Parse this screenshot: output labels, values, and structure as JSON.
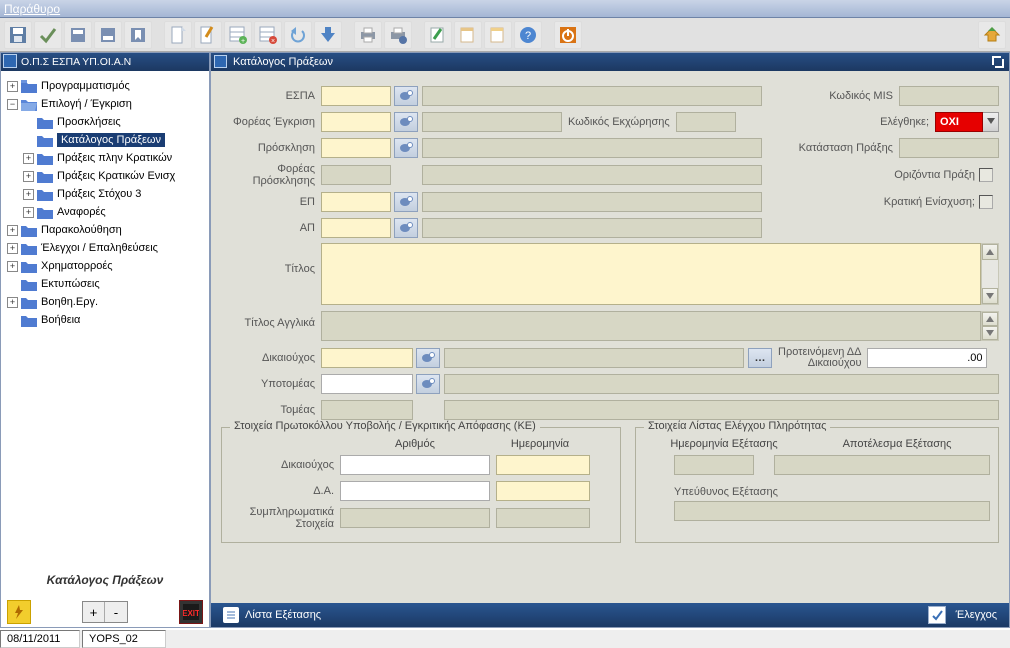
{
  "menu": {
    "window": "Παράθυρο"
  },
  "tree_panel_title": "Ο.Π.Σ ΕΣΠΑ ΥΠ.ΟΙ.Α.Ν",
  "tree": {
    "n1": "Προγραμματισμός",
    "n2": "Επιλογή / Έγκριση",
    "n2_1": "Προσκλήσεις",
    "n2_2": "Κατάλογος Πράξεων",
    "n2_3": "Πράξεις πλην Κρατικών",
    "n2_4": "Πράξεις Κρατικών Ενισχ",
    "n2_5": "Πράξεις Στόχου 3",
    "n2_6": "Αναφορές",
    "n3": "Παρακολούθηση",
    "n4": "Έλεγχοι / Επαληθεύσεις",
    "n5": "Χρηματορροές",
    "n6": "Εκτυπώσεις",
    "n7": "Βοηθη.Εργ.",
    "n8": "Βοήθεια"
  },
  "tree_caption": "Κατάλογος Πράξεων",
  "tree_buttons": {
    "plus": "+",
    "minus": "-"
  },
  "main_title": "Κατάλογος Πράξεων",
  "labels": {
    "espa": "ΕΣΠΑ",
    "foreas_egkrisis": "Φορέας Έγκριση",
    "kodikos_ekx": "Κωδικός Εκχώρησης",
    "kodikos_mis": "Κωδικός MIS",
    "elegxthike": "Ελέγθηκε;",
    "prosklisi": "Πρόσκληση",
    "katastasi_praxis": "Κατάσταση Πράξης",
    "foreas_prosklisis_l1": "Φορέας",
    "foreas_prosklisis_l2": "Πρόσκλησης",
    "orizontia": "Οριζόντια Πράξη",
    "ep": "ΕΠ",
    "kratiki": "Κρατική Ενίσχυση;",
    "ap": "ΑΠ",
    "titlos": "Τίτλος",
    "titlos_en": "Τίτλος Αγγλικά",
    "dikaiouxos": "Δικαιούχος",
    "proteinomeni_dd_l1": "Προτεινόμενη ΔΔ",
    "proteinomeni_dd_l2": "Δικαιούχου",
    "ypotomeas": "Υποτομέας",
    "tomeas": "Τομέας"
  },
  "values": {
    "elegxthike": "ΟΧΙ",
    "proteinomeni_dd": ".00"
  },
  "group1": {
    "title": "Στοιχεία Πρωτοκόλλου Υποβολής / Εγκριτικής Απόφασης (ΚΕ)",
    "col_arithmos": "Αριθμός",
    "col_imerominia": "Ημερομηνία",
    "row1": "Δικαιούχος",
    "row2": "Δ.Α.",
    "row3_l1": "Συμπληρωματικά",
    "row3_l2": "Στοιχεία"
  },
  "group2": {
    "title": "Στοιχεία Λίστας Ελέγχου Πληρότητας",
    "im_exetasis": "Ημερομηνία Εξέτασης",
    "apotelesma": "Αποτέλεσμα Εξέτασης",
    "ypeythynos": "Υπεύθυνος Εξέτασης"
  },
  "bottombar": {
    "lista": "Λίστα Εξέτασης",
    "elegxos": "Έλεγχος"
  },
  "status": {
    "date": "08/11/2011",
    "code": "YOPS_02"
  }
}
